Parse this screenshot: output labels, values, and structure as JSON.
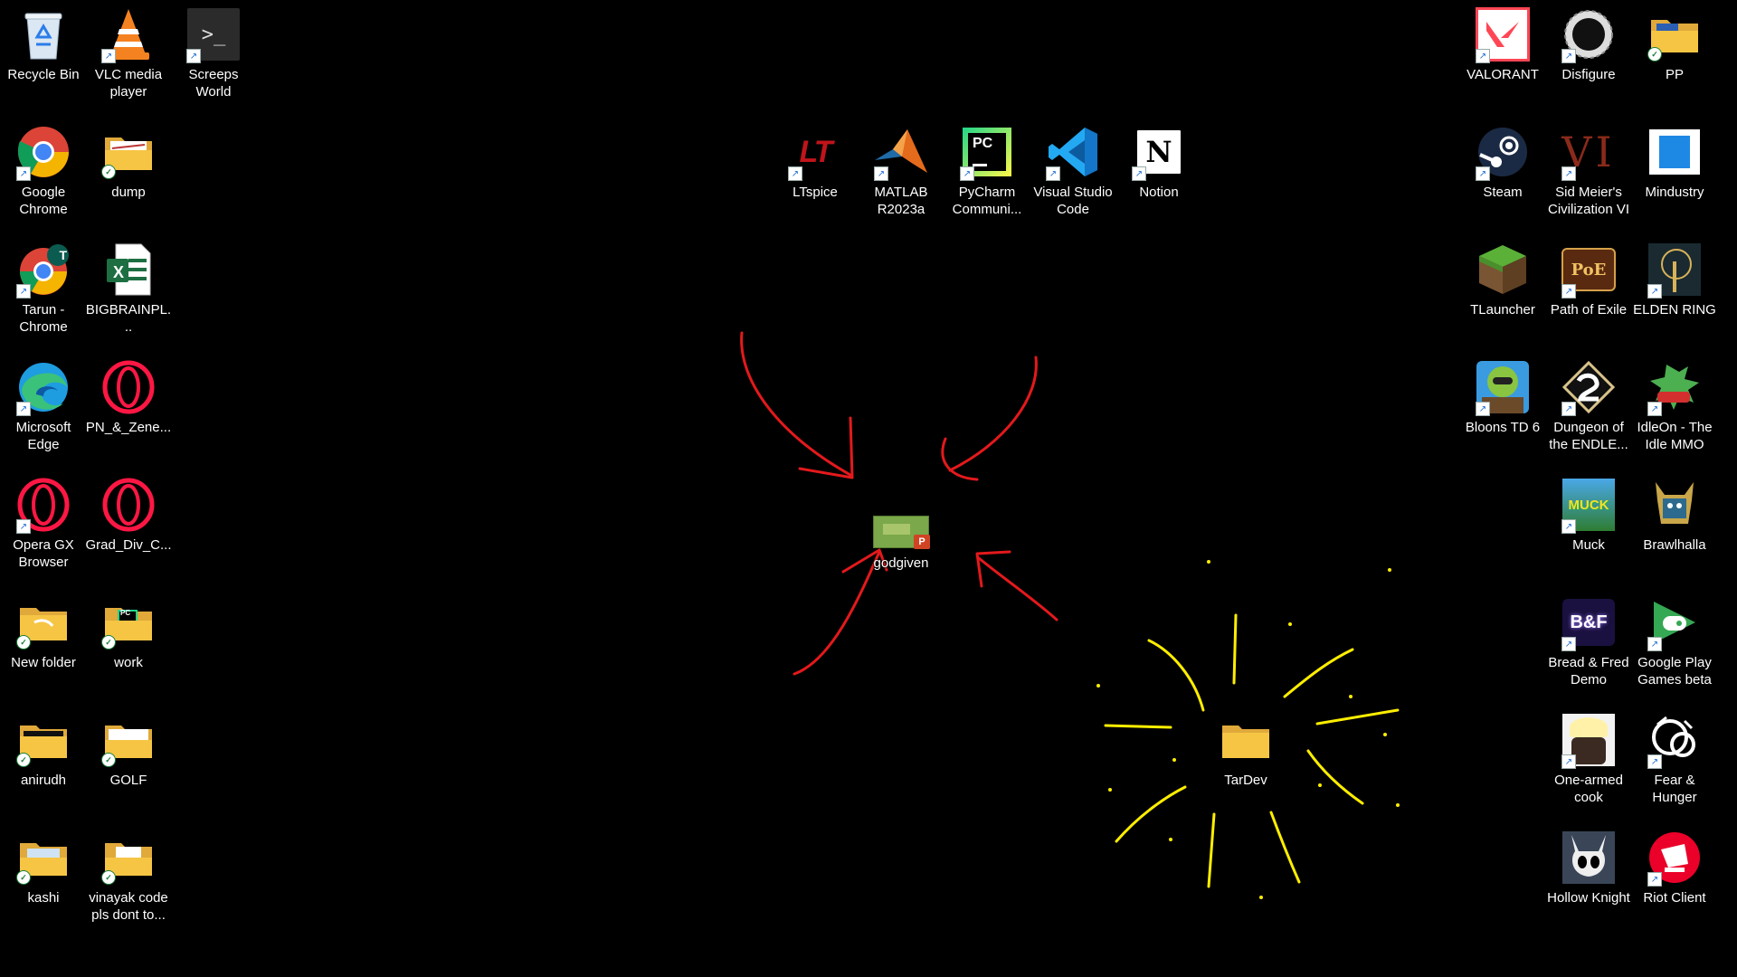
{
  "desktop": {
    "left_col1": [
      {
        "label": "Recycle Bin",
        "icon": "recycle-bin-icon"
      },
      {
        "label": "Google Chrome",
        "icon": "chrome-icon"
      },
      {
        "label": "Tarun - Chrome",
        "icon": "chrome-profile-icon",
        "badge": "T"
      },
      {
        "label": "Microsoft Edge",
        "icon": "edge-icon"
      },
      {
        "label": "Opera GX Browser",
        "icon": "opera-gx-icon"
      },
      {
        "label": "New folder",
        "icon": "folder-icon"
      },
      {
        "label": "anirudh",
        "icon": "folder-icon"
      },
      {
        "label": "kashi",
        "icon": "folder-icon"
      }
    ],
    "left_col2": [
      {
        "label": "VLC media player",
        "icon": "vlc-icon"
      },
      {
        "label": "dump",
        "icon": "folder-icon"
      },
      {
        "label": "BIGBRAINPL...",
        "icon": "excel-icon",
        "glyph": "X"
      },
      {
        "label": "PN_&_Zene...",
        "icon": "opera-icon"
      },
      {
        "label": "Grad_Div_C...",
        "icon": "opera-icon"
      },
      {
        "label": "work",
        "icon": "folder-icon",
        "glyph": "PC"
      },
      {
        "label": "GOLF",
        "icon": "folder-icon"
      },
      {
        "label": "vinayak code pls dont to...",
        "icon": "folder-icon"
      }
    ],
    "left_col3": [
      {
        "label": "Screeps World",
        "icon": "terminal-icon",
        "glyph": ">_"
      }
    ],
    "center_row": [
      {
        "label": "LTspice",
        "icon": "ltspice-icon",
        "glyph": "LT"
      },
      {
        "label": "MATLAB R2023a",
        "icon": "matlab-icon"
      },
      {
        "label": "PyCharm Communi...",
        "icon": "pycharm-icon",
        "glyph": "PC"
      },
      {
        "label": "Visual Studio Code",
        "icon": "vscode-icon"
      },
      {
        "label": "Notion",
        "icon": "notion-icon",
        "glyph": "N"
      }
    ],
    "center_file": {
      "label": "godgiven",
      "icon": "powerpoint-file-icon",
      "glyph": "P"
    },
    "tardev": {
      "label": "TarDev",
      "icon": "folder-icon"
    },
    "right_col1": [
      {
        "label": "VALORANT",
        "icon": "valorant-icon"
      },
      {
        "label": "Steam",
        "icon": "steam-icon"
      },
      {
        "label": "TLauncher",
        "icon": "tlauncher-icon"
      },
      {
        "label": "Bloons TD 6",
        "icon": "bloons-icon"
      }
    ],
    "right_col2": [
      {
        "label": "Disfigure",
        "icon": "disfigure-icon"
      },
      {
        "label": "Sid Meier's Civilization VI",
        "icon": "civilization-icon",
        "glyph": "VI"
      },
      {
        "label": "Path of Exile",
        "icon": "poe-icon",
        "glyph": "PoE"
      },
      {
        "label": "Dungeon of the ENDLE...",
        "icon": "endless-icon"
      },
      {
        "label": "Muck",
        "icon": "muck-icon",
        "glyph": "MUCK"
      },
      {
        "label": "Bread & Fred Demo",
        "icon": "bread-fred-icon",
        "glyph": "B&F"
      },
      {
        "label": "One-armed cook",
        "icon": "one-armed-cook-icon"
      },
      {
        "label": "Hollow Knight",
        "icon": "hollow-knight-icon"
      }
    ],
    "right_col3": [
      {
        "label": "PP",
        "icon": "folder-icon"
      },
      {
        "label": "Mindustry",
        "icon": "mindustry-icon"
      },
      {
        "label": "ELDEN RING",
        "icon": "elden-ring-icon"
      },
      {
        "label": "IdleOn - The Idle MMO",
        "icon": "idleon-icon"
      },
      {
        "label": "Brawlhalla",
        "icon": "brawlhalla-icon"
      },
      {
        "label": "Google Play Games beta",
        "icon": "google-play-games-icon"
      },
      {
        "label": "Fear & Hunger",
        "icon": "fear-hunger-icon"
      },
      {
        "label": "Riot Client",
        "icon": "riot-client-icon"
      }
    ]
  },
  "colors": {
    "background": "#000000",
    "annotation_red": "#e4191c",
    "annotation_yellow": "#ffee00",
    "folder": "#f6c544"
  }
}
